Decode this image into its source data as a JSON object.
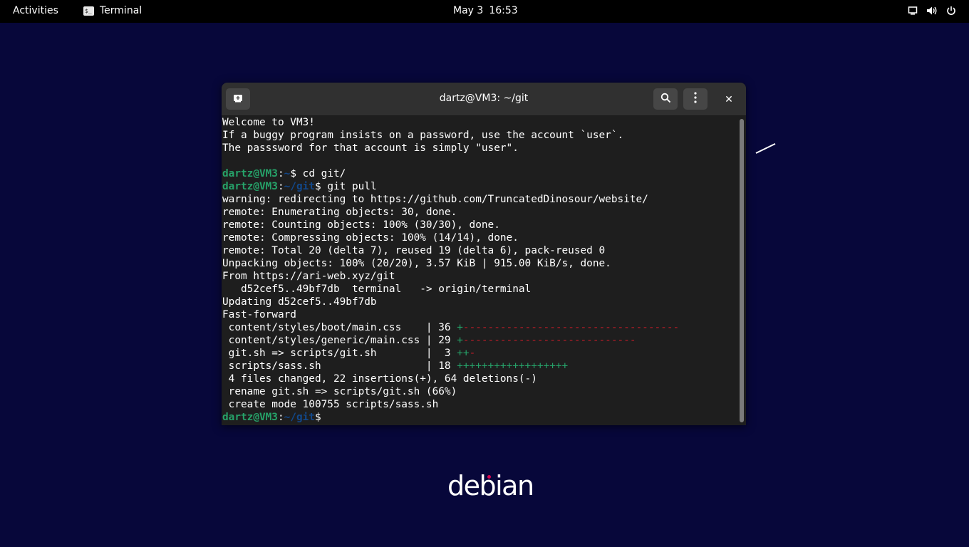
{
  "topbar": {
    "activities": "Activities",
    "app_name": "Terminal",
    "app_icon_glyph": "$_",
    "date": "May 3",
    "time": "16:53",
    "icons": [
      "screen-icon",
      "volume-icon",
      "power-icon"
    ]
  },
  "window": {
    "title": "dartz@VM3: ~/git",
    "buttons": [
      "new-tab-icon",
      "search-icon",
      "menu-icon",
      "close-icon"
    ],
    "close_glyph": "✕"
  },
  "terminal": {
    "welcome": [
      "Welcome to VM3!",
      "If a buggy program insists on a password, use the account `user`.",
      "The passsword for that account is simply \"user\"."
    ],
    "prompt_user": "dartz@VM3",
    "prompt_colon": ":",
    "prompt_home": "~",
    "prompt_git": "~/git",
    "prompt_dollar": "$",
    "cmd1": " cd git/",
    "cmd2": " git pull",
    "output": [
      "warning: redirecting to https://github.com/TruncatedDinosour/website/",
      "remote: Enumerating objects: 30, done.",
      "remote: Counting objects: 100% (30/30), done.",
      "remote: Compressing objects: 100% (14/14), done.",
      "remote: Total 20 (delta 7), reused 19 (delta 6), pack-reused 0",
      "Unpacking objects: 100% (20/20), 3.57 KiB | 915.00 KiB/s, done.",
      "From https://ari-web.xyz/git",
      "   d52cef5..49bf7db  terminal   -> origin/terminal",
      "Updating d52cef5..49bf7db",
      "Fast-forward"
    ],
    "diffstat": [
      {
        "file": " content/styles/boot/main.css    | 36 ",
        "plus": "+",
        "minus": "-----------------------------------"
      },
      {
        "file": " content/styles/generic/main.css | 29 ",
        "plus": "+",
        "minus": "----------------------------"
      },
      {
        "file": " git.sh => scripts/git.sh        |  3 ",
        "plus": "++",
        "minus": "-"
      },
      {
        "file": " scripts/sass.sh                 | 18 ",
        "plus": "++++++++++++++++++",
        "minus": ""
      }
    ],
    "summary": [
      " 4 files changed, 22 insertions(+), 64 deletions(-)",
      " rename git.sh => scripts/git.sh (66%)",
      " create mode 100755 scripts/sass.sh"
    ]
  },
  "desktop": {
    "logo_text": "debian"
  },
  "colors": {
    "desktop_bg": "#07073a",
    "prompt_green": "#26a269",
    "prompt_blue": "#12488b",
    "diff_red": "#c01c28"
  }
}
